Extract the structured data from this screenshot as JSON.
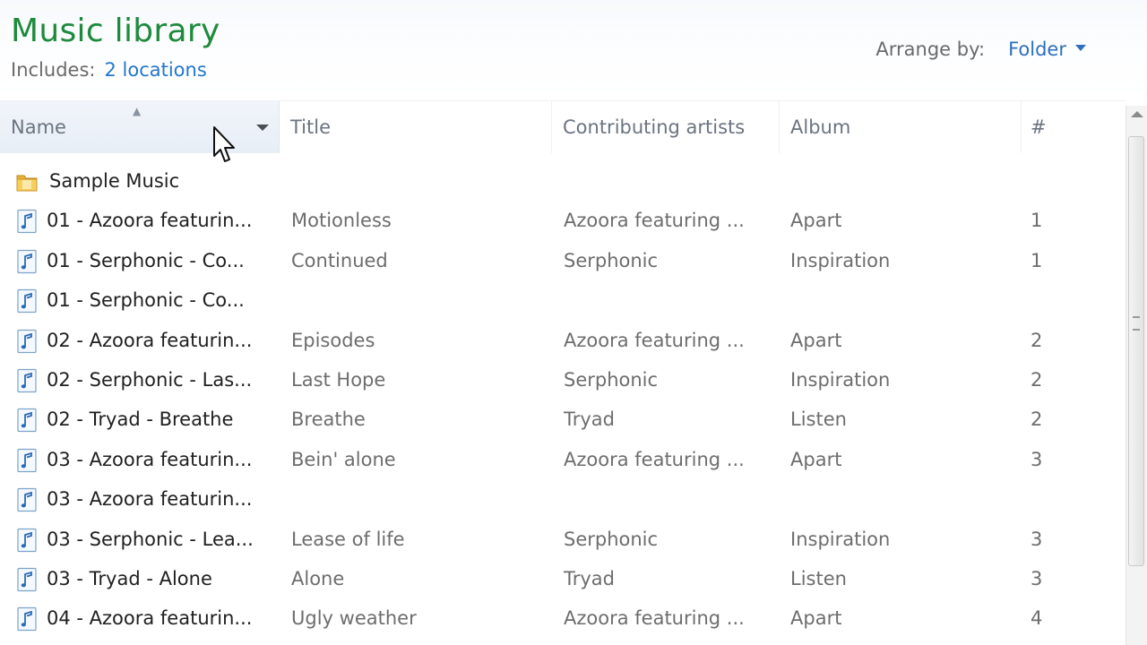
{
  "library": {
    "title": "Music library",
    "includes_label": "Includes:",
    "locations_link": "2 locations",
    "arrange_label": "Arrange by:",
    "arrange_value": "Folder"
  },
  "columns": {
    "name": "Name",
    "title": "Title",
    "artists": "Contributing artists",
    "album": "Album",
    "number": "#"
  },
  "folder": {
    "name": "Sample Music",
    "icon": "folder-icon"
  },
  "files": [
    {
      "name": "01 - Azoora featurin...",
      "title": "Motionless",
      "artist": "Azoora featuring ...",
      "album": "Apart",
      "number": "1"
    },
    {
      "name": "01 - Serphonic - Co...",
      "title": "Continued",
      "artist": "Serphonic",
      "album": "Inspiration",
      "number": "1"
    },
    {
      "name": "01 - Serphonic - Co...",
      "title": "",
      "artist": "",
      "album": "",
      "number": ""
    },
    {
      "name": "02 - Azoora featurin...",
      "title": "Episodes",
      "artist": "Azoora featuring ...",
      "album": "Apart",
      "number": "2"
    },
    {
      "name": "02 - Serphonic - Las...",
      "title": "Last Hope",
      "artist": "Serphonic",
      "album": "Inspiration",
      "number": "2"
    },
    {
      "name": "02 - Tryad - Breathe",
      "title": "Breathe",
      "artist": "Tryad",
      "album": "Listen",
      "number": "2"
    },
    {
      "name": "03 - Azoora featurin...",
      "title": "Bein' alone",
      "artist": "Azoora featuring ...",
      "album": "Apart",
      "number": "3"
    },
    {
      "name": "03 - Azoora featurin...",
      "title": "",
      "artist": "",
      "album": "",
      "number": ""
    },
    {
      "name": "03 - Serphonic - Lea...",
      "title": "Lease of life",
      "artist": "Serphonic",
      "album": "Inspiration",
      "number": "3"
    },
    {
      "name": "03 - Tryad - Alone",
      "title": "Alone",
      "artist": "Tryad",
      "album": "Listen",
      "number": "3"
    },
    {
      "name": "04 - Azoora featurin...",
      "title": "Ugly weather",
      "artist": "Azoora featuring ...",
      "album": "Apart",
      "number": "4"
    }
  ],
  "icons": {
    "file": "music-file-icon",
    "sort": "sort-ascending-icon",
    "dropdown": "chevron-down-icon",
    "cursor": "mouse-cursor-icon"
  },
  "colors": {
    "title_green": "#1e8a3c",
    "link_blue": "#2277cc",
    "header_text": "#6b7480",
    "cell_text": "#6d6d6d"
  }
}
